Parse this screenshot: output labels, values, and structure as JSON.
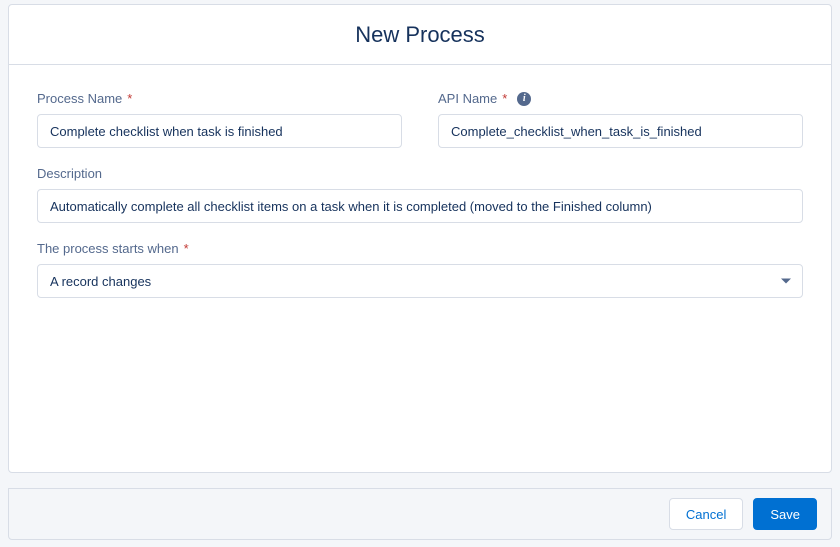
{
  "header": {
    "title": "New Process"
  },
  "fields": {
    "processName": {
      "label": "Process Name",
      "value": "Complete checklist when task is finished"
    },
    "apiName": {
      "label": "API Name",
      "value": "Complete_checklist_when_task_is_finished"
    },
    "description": {
      "label": "Description",
      "value": "Automatically complete all checklist items on a task when it is completed (moved to the Finished column)"
    },
    "startsWhen": {
      "label": "The process starts when",
      "value": "A record changes"
    }
  },
  "footer": {
    "cancel": "Cancel",
    "save": "Save"
  }
}
